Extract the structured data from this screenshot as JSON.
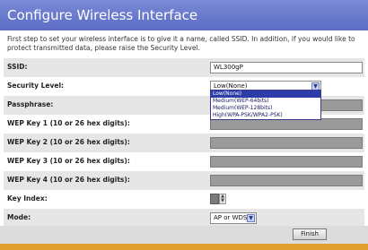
{
  "window": {
    "title": "Configure Wireless Interface"
  },
  "intro": {
    "text": "First step to set your wireless interface is to give it a name, called SSID. In addition, if you would like to protect transmitted data, please raise the Security Level."
  },
  "form": {
    "ssid_label": "SSID:",
    "ssid_value": "WL300gP",
    "security_label": "Security Level:",
    "security_value": "Low(None)",
    "security_options": [
      "Low(None)",
      "Medium(WEP-64bits)",
      "Medium(WEP-128bits)",
      "High(WPA-PSK/WPA2-PSK)"
    ],
    "passphrase_label": "Passphrase:",
    "wep1_label": "WEP Key 1 (10 or 26 hex digits):",
    "wep2_label": "WEP Key 2 (10 or 26 hex digits):",
    "wep3_label": "WEP Key 3 (10 or 26 hex digits):",
    "wep4_label": "WEP Key 4 (10 or 26 hex digits):",
    "keyindex_label": "Key Index:",
    "mode_label": "Mode:",
    "mode_value": "AP or WDS"
  },
  "footer": {
    "finish_label": "Finish"
  },
  "colors": {
    "titlebar": "#6a7bd0",
    "bottom_bar": "#e0a030",
    "selected_option": "#2c3da8"
  }
}
